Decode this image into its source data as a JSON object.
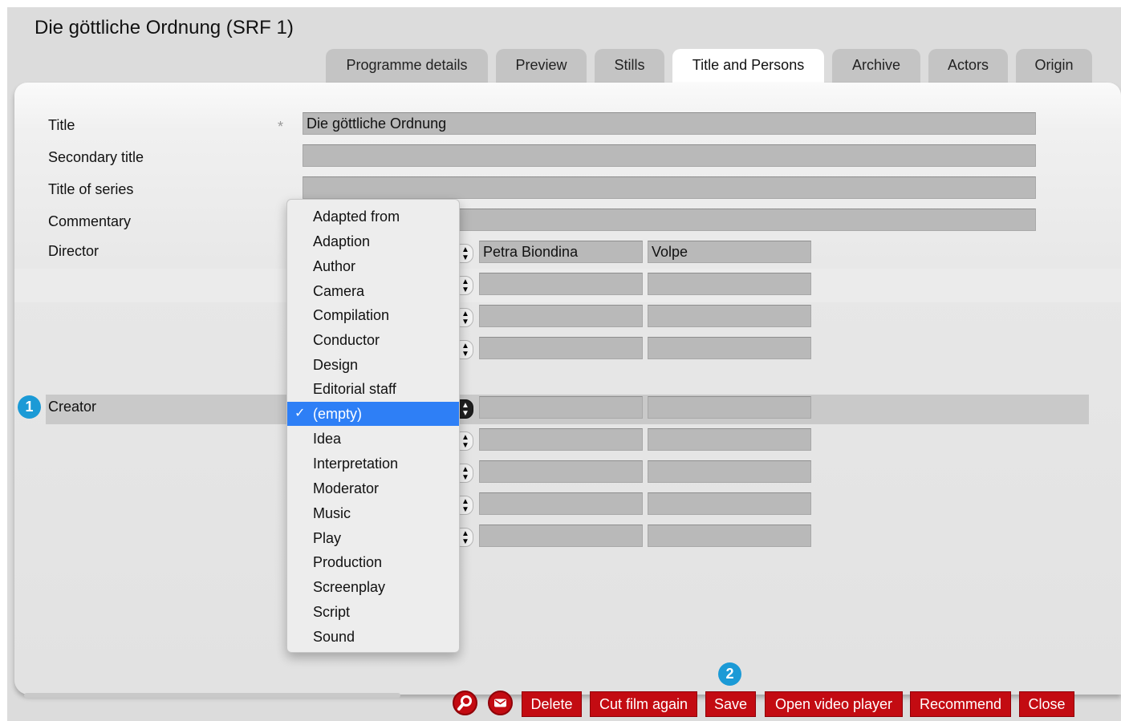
{
  "window": {
    "title": "Die göttliche Ordnung (SRF 1)"
  },
  "tabs": [
    {
      "label": "Programme details",
      "active": false
    },
    {
      "label": "Preview",
      "active": false
    },
    {
      "label": "Stills",
      "active": false
    },
    {
      "label": "Title and Persons",
      "active": true
    },
    {
      "label": "Archive",
      "active": false
    },
    {
      "label": "Actors",
      "active": false
    },
    {
      "label": "Origin",
      "active": false
    }
  ],
  "form": {
    "title_label": "Title",
    "required_marker": "*",
    "title_value": "Die göttliche Ordnung",
    "secondary_title_label": "Secondary title",
    "secondary_title_value": "",
    "title_of_series_label": "Title of series",
    "title_of_series_value": "",
    "commentary_label": "Commentary",
    "commentary_value": "",
    "director_label": "Director",
    "creator_label": "Creator"
  },
  "persons": [
    {
      "first_name": "Petra Biondina",
      "last_name": "Volpe"
    },
    {
      "first_name": "",
      "last_name": ""
    },
    {
      "first_name": "",
      "last_name": ""
    },
    {
      "first_name": "",
      "last_name": ""
    },
    {
      "first_name": "",
      "last_name": ""
    },
    {
      "first_name": "",
      "last_name": ""
    },
    {
      "first_name": "",
      "last_name": ""
    },
    {
      "first_name": "",
      "last_name": ""
    },
    {
      "first_name": "",
      "last_name": ""
    }
  ],
  "role_dropdown": {
    "selected": "(empty)",
    "check_mark": "✓",
    "options": [
      "Adapted from",
      "Adaption",
      "Author",
      "Camera",
      "Compilation",
      "Conductor",
      "Design",
      "Editorial staff",
      "(empty)",
      "Idea",
      "Interpretation",
      "Moderator",
      "Music",
      "Play",
      "Production",
      "Screenplay",
      "Script",
      "Sound"
    ]
  },
  "badges": {
    "creator": "1",
    "save": "2"
  },
  "icons": {
    "search": "search-icon",
    "mail": "mail-icon"
  },
  "actions": {
    "delete": "Delete",
    "cut_film_again": "Cut film again",
    "save": "Save",
    "open_video_player": "Open video player",
    "recommend": "Recommend",
    "close": "Close"
  },
  "colors": {
    "accent_red": "#c30b12",
    "selection_blue": "#2e7ff6",
    "badge_blue": "#1b9ad6"
  }
}
